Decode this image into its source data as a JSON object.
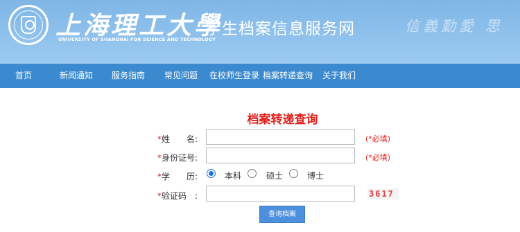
{
  "header": {
    "school_name": "上海理工大學",
    "school_name_en": "UNIVERSITY OF SHANGHAI FOR SCIENCE AND TECHNOLOGY",
    "site_title": "学生档案信息服务网",
    "motto": "信義勤愛 思",
    "logo_icon": "university-seal-icon"
  },
  "nav": {
    "items": [
      "首页",
      "新闻通知",
      "服务指南",
      "常见问题",
      "在校师生登录",
      "档案转递查询",
      "关于我们"
    ]
  },
  "form": {
    "title": "档案转递查询",
    "required_mark": "*",
    "name_label": "姓　　名:",
    "name_value": "",
    "name_hint": "(*必填)",
    "id_label": "身份证号:",
    "id_value": "",
    "id_hint": "(*必填)",
    "degree_label": "学　　历:",
    "degree_options": [
      "本科",
      "硕士",
      "博士"
    ],
    "degree_selected": "本科",
    "captcha_label": "验证码　:",
    "captcha_value": "",
    "captcha_text": "3617",
    "submit_label": "查询档案"
  },
  "colors": {
    "header_bg": "#8fc1ec",
    "nav_bg": "#3b8ad0",
    "title_red": "#e0201b",
    "button_blue": "#4c8fdc"
  }
}
